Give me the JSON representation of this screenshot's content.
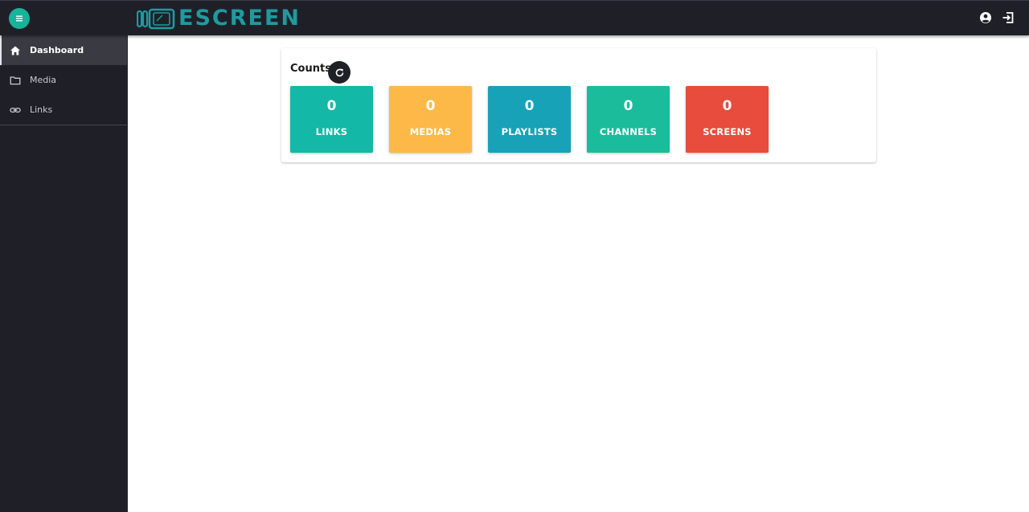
{
  "header": {
    "logo_text": "ESCREEN",
    "menu_icon": "hamburger-icon",
    "user_icon": "account-circle-icon",
    "logout_icon": "logout-icon",
    "accent_color": "#17b39b",
    "logo_color": "#1f9aa0"
  },
  "sidebar": {
    "items": [
      {
        "label": "Dashboard",
        "icon": "home-icon",
        "active": true
      },
      {
        "label": "Media",
        "icon": "folder-icon",
        "active": false
      },
      {
        "label": "Links",
        "icon": "link-icon",
        "active": false
      }
    ]
  },
  "counts": {
    "title": "Counts",
    "refresh_icon": "refresh-icon",
    "tiles": [
      {
        "value": "0",
        "label": "LINKS",
        "color": "#14b8a6"
      },
      {
        "value": "0",
        "label": "MEDIAS",
        "color": "#fdb948"
      },
      {
        "value": "0",
        "label": "PLAYLISTS",
        "color": "#17a2b8"
      },
      {
        "value": "0",
        "label": "CHANNELS",
        "color": "#1abc9c"
      },
      {
        "value": "0",
        "label": "SCREENS",
        "color": "#e74c3c"
      }
    ]
  }
}
